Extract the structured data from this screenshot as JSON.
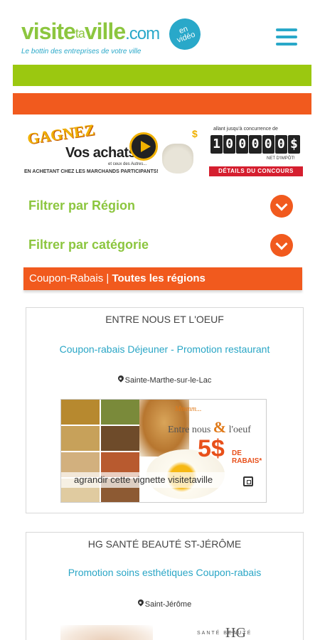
{
  "header": {
    "logo": {
      "part1": "visite",
      "part2": "ta",
      "part3": "ville",
      "part4": ".com",
      "tagline": "Le bottin des entreprises de votre ville"
    },
    "video_badge": {
      "line1": "en",
      "line2": "vidéo"
    },
    "menu_icon": "hamburger-menu-icon"
  },
  "banner": {
    "gagnez": "GAGNEZ",
    "vos_achats": "Vos achats",
    "sub1": "et ceux des Autres...",
    "sub2": "EN ACHETANT CHEZ LES MARCHANDS PARTICIPANTS!",
    "top_right": "allant jusqu'à concurrence de",
    "amount_digits": [
      "1",
      "0",
      "0",
      "0",
      "0",
      "0",
      "$"
    ],
    "net": "NET D'IMPÔT!",
    "details_label": "DÉTAILS DU CONCOURS"
  },
  "filters": {
    "region_label": "Filtrer par Région",
    "category_label": "Filtrer par catégorie"
  },
  "section": {
    "label": "Coupon-Rabais",
    "separator": " | ",
    "region": "Toutes les régions"
  },
  "listings": [
    {
      "name": "ENTRE NOUS ET L'OEUF",
      "title": "Coupon-rabais Déjeuner - Promotion restaurant",
      "location": "Sainte-Marthe-sur-le-Lac",
      "coupon": {
        "hmm": "Mmmm...",
        "brand_a": "Entre nous ",
        "brand_amp": "&",
        "brand_b": " l'oeuf",
        "amount": "5$",
        "rabais": "DE RABAIS*",
        "caption": "agrandir cette vignette visitetaville"
      }
    },
    {
      "name": "HG SANTÉ BEAUTÉ ST-JÉRÔME",
      "title": "Promotion soins esthétiques Coupon-rabais",
      "location": "Saint-Jérôme",
      "logo_text": "SANTÉ   BEAUTÉ",
      "logo_mark": "HG"
    }
  ],
  "colors": {
    "green": "#9bc810",
    "orange": "#f15a1e",
    "blue": "#29a8c9"
  }
}
